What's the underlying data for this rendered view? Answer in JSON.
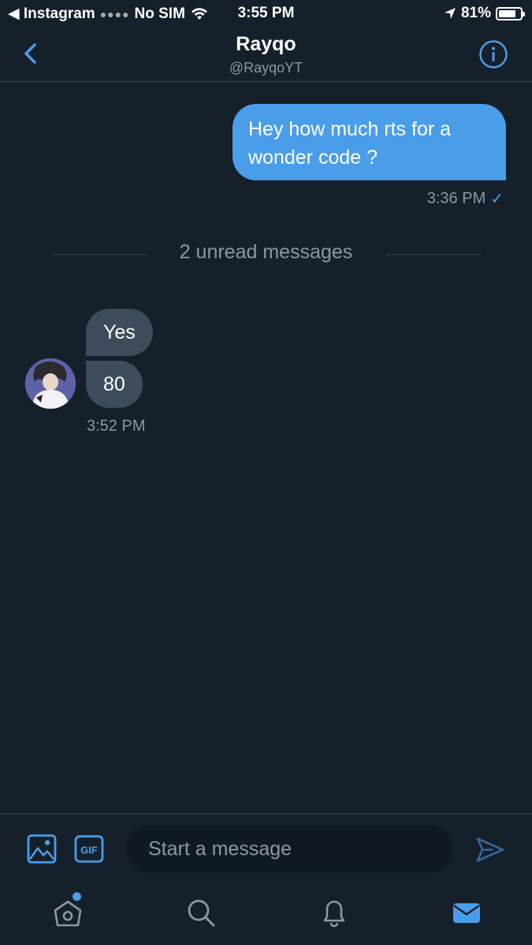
{
  "status_bar": {
    "back_app": "◀ Instagram",
    "signal": "No SIM",
    "time": "3:55 PM",
    "battery": "81%",
    "battery_level": 0.81
  },
  "header": {
    "title": "Rayqo",
    "handle": "@RayqoYT"
  },
  "messages": {
    "outgoing": {
      "text": "Hey how much rts for a wonder code ?",
      "time": "3:36 PM",
      "status_icon": "✓"
    },
    "unread_divider": "2 unread messages",
    "incoming": [
      {
        "text": "Yes"
      },
      {
        "text": "80"
      }
    ],
    "incoming_time": "3:52 PM"
  },
  "composer": {
    "placeholder": "Start a message",
    "gif_label": "GIF"
  },
  "colors": {
    "background": "#15202b",
    "accent": "#4a9de8",
    "incoming_bubble": "#3d4b5a",
    "muted_text": "#8899a6"
  }
}
